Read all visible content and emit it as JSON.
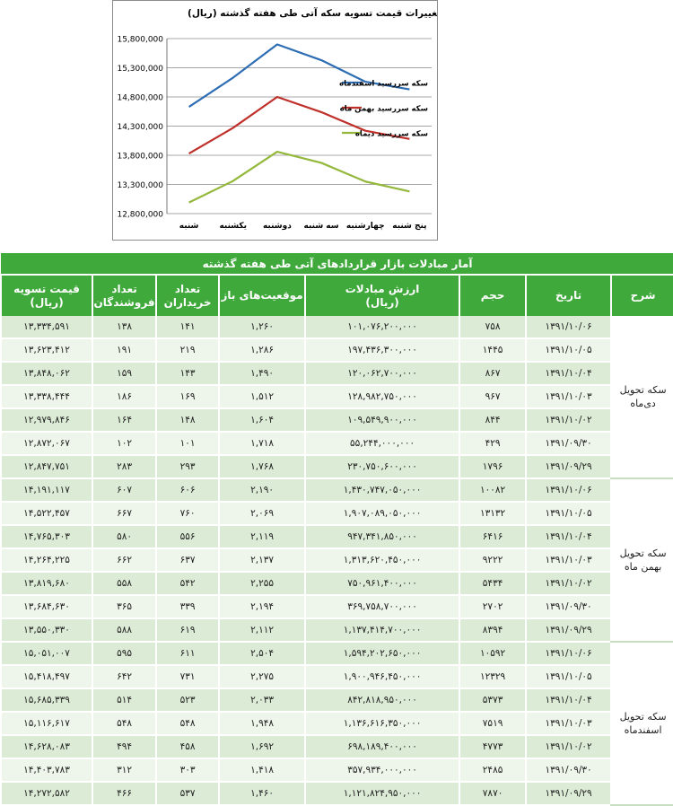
{
  "chart_data": {
    "type": "line",
    "title": "تغییرات قیمت تسویه سکه آتی طی هفته گذشته (ریال)",
    "categories": [
      "شنبه",
      "یکشنبه",
      "دوشنبه",
      "سه شنبه",
      "چهارشنبه",
      "پنج شنبه"
    ],
    "ylim": [
      12800000,
      15800000
    ],
    "yticks": [
      12800000,
      13300000,
      13800000,
      14300000,
      14800000,
      15300000,
      15800000
    ],
    "ytick_labels": [
      "12,800,000",
      "13,300,000",
      "13,800,000",
      "14,300,000",
      "14,800,000",
      "15,300,000",
      "15,800,000"
    ],
    "grid": "horizontal",
    "legend": "right",
    "series": [
      {
        "name": "سکه سررسید اسفندماه",
        "color": "#2e6db4",
        "values": [
          14630000,
          15130000,
          15700000,
          15430000,
          15060000,
          14930000
        ]
      },
      {
        "name": "سکه سررسید بهمن ماه",
        "color": "#c0302b",
        "values": [
          13830000,
          14270000,
          14800000,
          14540000,
          14220000,
          14080000
        ]
      },
      {
        "name": "سکه سررسید دیماه",
        "color": "#93b83b",
        "values": [
          12990000,
          13360000,
          13860000,
          13670000,
          13350000,
          13180000
        ]
      }
    ]
  },
  "table": {
    "title": "آمار مبادلات بازار قراردادهای آتی طی هفته گذشته",
    "headers": {
      "desc": "شرح",
      "date": "تاریخ",
      "volume": "حجم",
      "value": "ارزش مبادلات\n(ریال)",
      "open": "موقعیت‌های باز",
      "buyers": "تعداد\nخریداران",
      "sellers": "تعداد\nفروشندگان",
      "price": "قیمت تسویه\n(ریال)"
    },
    "groups": [
      {
        "label": "سکه تحویل\nدی‌ماه",
        "rows": [
          {
            "date": "۱۳۹۱/۱۰/۰۶",
            "volume": "۷۵۸",
            "value": "۱۰۱,۰۷۶,۲۰۰,۰۰۰",
            "open": "۱,۲۶۰",
            "buyers": "۱۴۱",
            "sellers": "۱۳۸",
            "price": "۱۳,۳۳۴,۵۹۱"
          },
          {
            "date": "۱۳۹۱/۱۰/۰۵",
            "volume": "۱۴۴۵",
            "value": "۱۹۷,۴۳۶,۳۰۰,۰۰۰",
            "open": "۱,۲۸۶",
            "buyers": "۲۱۹",
            "sellers": "۱۹۱",
            "price": "۱۳,۶۲۳,۴۱۲"
          },
          {
            "date": "۱۳۹۱/۱۰/۰۴",
            "volume": "۸۶۷",
            "value": "۱۲۰,۰۶۲,۷۰۰,۰۰۰",
            "open": "۱,۴۹۰",
            "buyers": "۱۴۳",
            "sellers": "۱۵۹",
            "price": "۱۳,۸۴۸,۰۶۲"
          },
          {
            "date": "۱۳۹۱/۱۰/۰۳",
            "volume": "۹۶۷",
            "value": "۱۲۸,۹۸۲,۷۵۰,۰۰۰",
            "open": "۱,۵۱۲",
            "buyers": "۱۶۹",
            "sellers": "۱۸۶",
            "price": "۱۳,۳۳۸,۴۴۴"
          },
          {
            "date": "۱۳۹۱/۱۰/۰۲",
            "volume": "۸۴۴",
            "value": "۱۰۹,۵۴۹,۹۰۰,۰۰۰",
            "open": "۱,۶۰۴",
            "buyers": "۱۴۸",
            "sellers": "۱۶۴",
            "price": "۱۲,۹۷۹,۸۴۶"
          },
          {
            "date": "۱۳۹۱/۰۹/۳۰",
            "volume": "۴۲۹",
            "value": "۵۵,۲۴۴,۰۰۰,۰۰۰",
            "open": "۱,۷۱۸",
            "buyers": "۱۰۱",
            "sellers": "۱۰۲",
            "price": "۱۲,۸۷۲,۰۶۷"
          },
          {
            "date": "۱۳۹۱/۰۹/۲۹",
            "volume": "۱۷۹۶",
            "value": "۲۳۰,۷۵۰,۶۰۰,۰۰۰",
            "open": "۱,۷۶۸",
            "buyers": "۲۹۳",
            "sellers": "۲۸۳",
            "price": "۱۲,۸۴۷,۷۵۱"
          }
        ]
      },
      {
        "label": "سکه تحویل\nبهمن ماه",
        "rows": [
          {
            "date": "۱۳۹۱/۱۰/۰۶",
            "volume": "۱۰۰۸۲",
            "value": "۱,۴۳۰,۷۴۷,۰۵۰,۰۰۰",
            "open": "۲,۱۹۰",
            "buyers": "۶۰۶",
            "sellers": "۶۰۷",
            "price": "۱۴,۱۹۱,۱۱۷"
          },
          {
            "date": "۱۳۹۱/۱۰/۰۵",
            "volume": "۱۳۱۳۲",
            "value": "۱,۹۰۷,۰۸۹,۰۵۰,۰۰۰",
            "open": "۲,۰۶۹",
            "buyers": "۷۶۰",
            "sellers": "۶۶۷",
            "price": "۱۴,۵۲۲,۴۵۷"
          },
          {
            "date": "۱۳۹۱/۱۰/۰۴",
            "volume": "۶۴۱۶",
            "value": "۹۴۷,۳۴۱,۸۵۰,۰۰۰",
            "open": "۲,۱۱۹",
            "buyers": "۵۵۶",
            "sellers": "۵۸۰",
            "price": "۱۴,۷۶۵,۳۰۳"
          },
          {
            "date": "۱۳۹۱/۱۰/۰۳",
            "volume": "۹۲۲۲",
            "value": "۱,۳۱۳,۶۲۰,۴۵۰,۰۰۰",
            "open": "۲,۱۳۷",
            "buyers": "۶۳۷",
            "sellers": "۶۶۲",
            "price": "۱۴,۲۶۴,۲۲۵"
          },
          {
            "date": "۱۳۹۱/۱۰/۰۲",
            "volume": "۵۴۳۴",
            "value": "۷۵۰,۹۶۱,۴۰۰,۰۰۰",
            "open": "۲,۲۵۵",
            "buyers": "۵۴۲",
            "sellers": "۵۵۸",
            "price": "۱۳,۸۱۹,۶۸۰"
          },
          {
            "date": "۱۳۹۱/۰۹/۳۰",
            "volume": "۲۷۰۲",
            "value": "۳۶۹,۷۵۸,۷۰۰,۰۰۰",
            "open": "۲,۱۹۴",
            "buyers": "۳۳۹",
            "sellers": "۳۶۵",
            "price": "۱۳,۶۸۴,۶۳۰"
          },
          {
            "date": "۱۳۹۱/۰۹/۲۹",
            "volume": "۸۳۹۴",
            "value": "۱,۱۳۷,۴۱۴,۷۰۰,۰۰۰",
            "open": "۲,۱۱۲",
            "buyers": "۶۱۹",
            "sellers": "۵۸۸",
            "price": "۱۳,۵۵۰,۳۳۰"
          }
        ]
      },
      {
        "label": "سکه تحویل\nاسفندماه",
        "rows": [
          {
            "date": "۱۳۹۱/۱۰/۰۶",
            "volume": "۱۰۵۹۲",
            "value": "۱,۵۹۴,۲۰۲,۶۵۰,۰۰۰",
            "open": "۲,۵۰۴",
            "buyers": "۶۱۱",
            "sellers": "۵۹۵",
            "price": "۱۵,۰۵۱,۰۰۷"
          },
          {
            "date": "۱۳۹۱/۱۰/۰۵",
            "volume": "۱۲۳۲۹",
            "value": "۱,۹۰۰,۹۴۶,۴۵۰,۰۰۰",
            "open": "۲,۲۷۵",
            "buyers": "۷۳۱",
            "sellers": "۶۴۲",
            "price": "۱۵,۴۱۸,۴۹۷"
          },
          {
            "date": "۱۳۹۱/۱۰/۰۴",
            "volume": "۵۳۷۳",
            "value": "۸۴۲,۸۱۸,۹۵۰,۰۰۰",
            "open": "۲,۰۳۳",
            "buyers": "۵۲۳",
            "sellers": "۵۱۴",
            "price": "۱۵,۶۸۵,۳۳۹"
          },
          {
            "date": "۱۳۹۱/۱۰/۰۳",
            "volume": "۷۵۱۹",
            "value": "۱,۱۳۶,۶۱۶,۳۵۰,۰۰۰",
            "open": "۱,۹۴۸",
            "buyers": "۵۴۸",
            "sellers": "۵۴۸",
            "price": "۱۵,۱۱۶,۶۱۷"
          },
          {
            "date": "۱۳۹۱/۱۰/۰۲",
            "volume": "۴۷۷۳",
            "value": "۶۹۸,۱۸۹,۴۰۰,۰۰۰",
            "open": "۱,۶۹۲",
            "buyers": "۴۵۸",
            "sellers": "۴۹۴",
            "price": "۱۴,۶۲۸,۰۸۳"
          },
          {
            "date": "۱۳۹۱/۰۹/۳۰",
            "volume": "۲۴۸۵",
            "value": "۳۵۷,۹۳۴,۰۰۰,۰۰۰",
            "open": "۱,۴۱۸",
            "buyers": "۳۰۳",
            "sellers": "۳۱۲",
            "price": "۱۴,۴۰۳,۷۸۳"
          },
          {
            "date": "۱۳۹۱/۰۹/۲۹",
            "volume": "۷۸۷۰",
            "value": "۱,۱۲۱,۸۲۴,۹۵۰,۰۰۰",
            "open": "۱,۴۶۰",
            "buyers": "۵۳۷",
            "sellers": "۴۶۶",
            "price": "۱۴,۲۷۲,۵۸۲"
          }
        ]
      }
    ]
  }
}
